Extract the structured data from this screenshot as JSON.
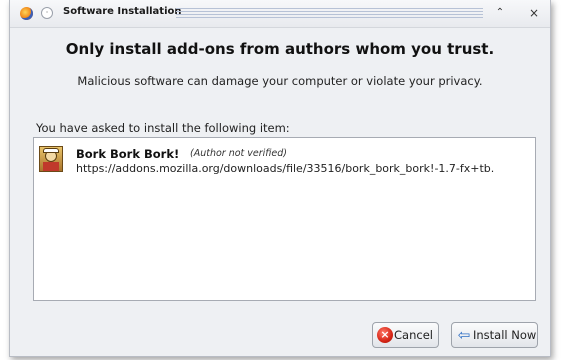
{
  "window": {
    "title": "Software Installation",
    "titlebar_buttons": {
      "shade_icon": "chevron-up-icon",
      "close_icon": "close-icon"
    }
  },
  "dialog": {
    "headline": "Only install add-ons from authors whom you trust.",
    "warning": "Malicious software can damage your computer or violate your privacy.",
    "asked_label": "You have asked to install the following item:"
  },
  "items": [
    {
      "name": "Bork Bork Bork!",
      "verification": "(Author not verified)",
      "url": "https://addons.mozilla.org/downloads/file/33516/bork_bork_bork!-1.7-fx+tb.",
      "icon": "swedish-chef-icon"
    }
  ],
  "buttons": {
    "cancel": "Cancel",
    "install": "Install Now"
  },
  "colors": {
    "window_bg": "#eef0f3",
    "cancel_icon": "#d62516",
    "install_icon": "#2f6fc4"
  }
}
